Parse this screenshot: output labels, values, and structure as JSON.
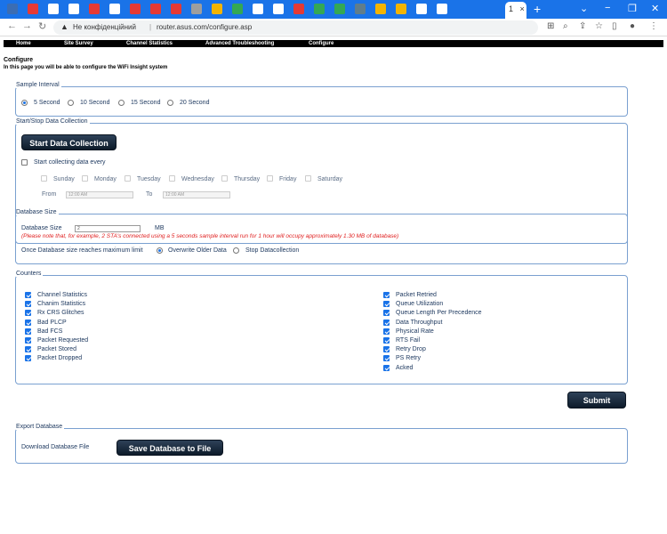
{
  "browser": {
    "active_tab_label": "1",
    "close_tab": "×",
    "new_tab": "+",
    "security_label": "Не конфіденційний",
    "url": "router.asus.com/configure.asp",
    "window_controls": [
      "⌄",
      "−",
      "❐",
      "✕"
    ],
    "tab_icon_colors": [
      "#3b6db3",
      "#e53935",
      "#ffffff",
      "#ffffff",
      "#e53935",
      "#ffffff",
      "#e53935",
      "#e53935",
      "#e53935",
      "#9e9e9e",
      "#f4b400",
      "#34a853",
      "#ffffff",
      "#ffffff",
      "#e53935",
      "#34a853",
      "#34a853",
      "#607d8b",
      "#f4b400",
      "#f4b400",
      "#ffffff",
      "#ffffff"
    ]
  },
  "nav": {
    "home": "Home",
    "site_survey": "Site Survey",
    "channel_statistics": "Channel Statistics",
    "advanced_troubleshooting": "Advanced Troubleshooting",
    "configure": "Configure"
  },
  "page": {
    "title": "Configure",
    "subtitle": "In this page you will be able to configure the WiFi Insight system"
  },
  "sample_interval": {
    "legend": "Sample Interval",
    "options": [
      "5 Second",
      "10 Second",
      "15 Second",
      "20 Second"
    ],
    "selected": "5 Second"
  },
  "collection": {
    "legend": "Start/Stop Data Collection",
    "start_button": "Start Data Collection",
    "schedule_label": "Start collecting data every",
    "days": [
      "Sunday",
      "Monday",
      "Tuesday",
      "Wednesday",
      "Thursday",
      "Friday",
      "Saturday"
    ],
    "from_label": "From",
    "from_value": "12:00 AM",
    "to_label": "To",
    "to_value": "12:00 AM"
  },
  "database": {
    "legend": "Database Size",
    "size_label": "Database Size",
    "size_value": "2",
    "unit": "MB",
    "note": "(Please note that, for example, 2 STA's connected using a 5 seconds sample interval run for 1 hour will occupy approximately 1.30 MB of database)",
    "max_label": "Once Database size reaches maximum limit",
    "options": [
      "Overwrite Older Data",
      "Stop Datacollection"
    ],
    "selected": "Overwrite Older Data"
  },
  "counters": {
    "legend": "Counters",
    "left": [
      "Channel Statistics",
      "Chanim Statistics",
      "Rx CRS Glitches",
      "Bad PLCP",
      "Bad FCS",
      "Packet Requested",
      "Packet Stored",
      "Packet Dropped"
    ],
    "right": [
      "Packet Retried",
      "Queue Utilization",
      "Queue Length Per Precedence",
      "Data Throughput",
      "Physical Rate",
      "RTS Fail",
      "Retry Drop",
      "PS Retry",
      "Acked"
    ]
  },
  "submit_label": "Submit",
  "export": {
    "legend": "Export Database",
    "download_label": "Download Database File",
    "save_button": "Save Database to File"
  }
}
